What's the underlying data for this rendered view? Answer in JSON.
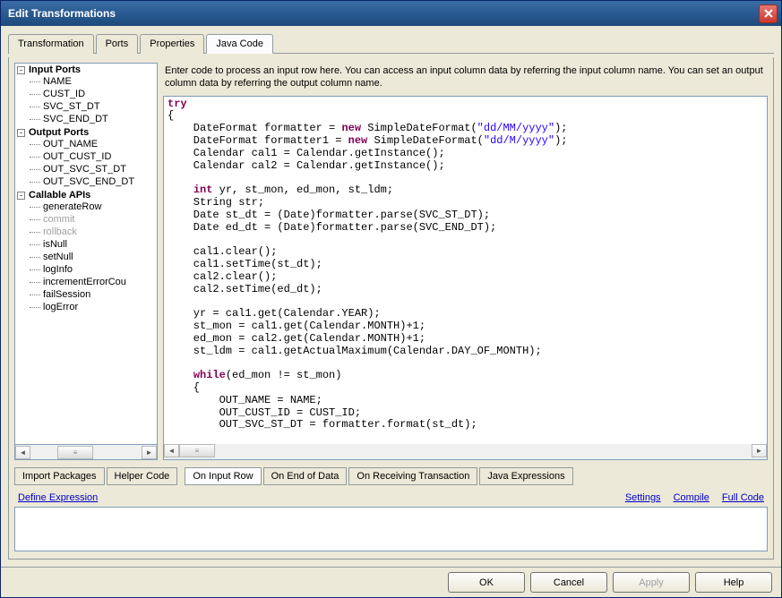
{
  "window": {
    "title": "Edit Transformations"
  },
  "topTabs": [
    "Transformation",
    "Ports",
    "Properties",
    "Java Code"
  ],
  "activeTopTab": 3,
  "tree": {
    "groups": [
      {
        "label": "Input Ports",
        "items": [
          {
            "label": "NAME"
          },
          {
            "label": "CUST_ID"
          },
          {
            "label": "SVC_ST_DT"
          },
          {
            "label": "SVC_END_DT"
          }
        ]
      },
      {
        "label": "Output Ports",
        "items": [
          {
            "label": "OUT_NAME"
          },
          {
            "label": "OUT_CUST_ID"
          },
          {
            "label": "OUT_SVC_ST_DT"
          },
          {
            "label": "OUT_SVC_END_DT"
          }
        ]
      },
      {
        "label": "Callable APIs",
        "items": [
          {
            "label": "generateRow"
          },
          {
            "label": "commit",
            "disabled": true
          },
          {
            "label": "rollback",
            "disabled": true
          },
          {
            "label": "isNull"
          },
          {
            "label": "setNull"
          },
          {
            "label": "logInfo"
          },
          {
            "label": "incrementErrorCou"
          },
          {
            "label": "failSession"
          },
          {
            "label": "logError"
          }
        ]
      }
    ]
  },
  "instructions": "Enter code to process an input row here. You can access an input column data by referring the input column name. You can set an output column data by referring the output column name.",
  "code": {
    "lines": [
      {
        "t": "try",
        "cls": "kw"
      },
      {
        "t": "{"
      },
      {
        "t": "    DateFormat formatter = ",
        "a": "new",
        "b": " SimpleDateFormat(",
        "s": "\"dd/MM/yyyy\"",
        "c": ");"
      },
      {
        "t": "    DateFormat formatter1 = ",
        "a": "new",
        "b": " SimpleDateFormat(",
        "s": "\"dd/M/yyyy\"",
        "c": ");"
      },
      {
        "t": "    Calendar cal1 = Calendar.getInstance();"
      },
      {
        "t": "    Calendar cal2 = Calendar.getInstance();"
      },
      {
        "t": ""
      },
      {
        "t": "    ",
        "a": "int",
        "b": " yr, st_mon, ed_mon, st_ldm;"
      },
      {
        "t": "    String str;"
      },
      {
        "t": "    Date st_dt = (Date)formatter.parse(SVC_ST_DT);"
      },
      {
        "t": "    Date ed_dt = (Date)formatter.parse(SVC_END_DT);"
      },
      {
        "t": ""
      },
      {
        "t": "    cal1.clear();"
      },
      {
        "t": "    cal1.setTime(st_dt);"
      },
      {
        "t": "    cal2.clear();"
      },
      {
        "t": "    cal2.setTime(ed_dt);"
      },
      {
        "t": ""
      },
      {
        "t": "    yr = cal1.get(Calendar.YEAR);"
      },
      {
        "t": "    st_mon = cal1.get(Calendar.MONTH)+1;"
      },
      {
        "t": "    ed_mon = cal2.get(Calendar.MONTH)+1;"
      },
      {
        "t": "    st_ldm = cal1.getActualMaximum(Calendar.DAY_OF_MONTH);"
      },
      {
        "t": ""
      },
      {
        "t": "    ",
        "a": "while",
        "b": "(ed_mon != st_mon)"
      },
      {
        "t": "    {"
      },
      {
        "t": "        OUT_NAME = NAME;"
      },
      {
        "t": "        OUT_CUST_ID = CUST_ID;"
      },
      {
        "t": "        OUT_SVC_ST_DT = formatter.format(st_dt);"
      }
    ]
  },
  "bottomRow1": [
    "Import Packages",
    "Helper Code"
  ],
  "bottomRow2": [
    "On Input Row",
    "On End of Data",
    "On Receiving Transaction",
    "Java Expressions"
  ],
  "activeBottomRow2": 0,
  "links": {
    "left": "Define Expression",
    "right": [
      "Settings",
      "Compile",
      "Full Code"
    ]
  },
  "footer": {
    "ok": "OK",
    "cancel": "Cancel",
    "apply": "Apply",
    "help": "Help"
  }
}
